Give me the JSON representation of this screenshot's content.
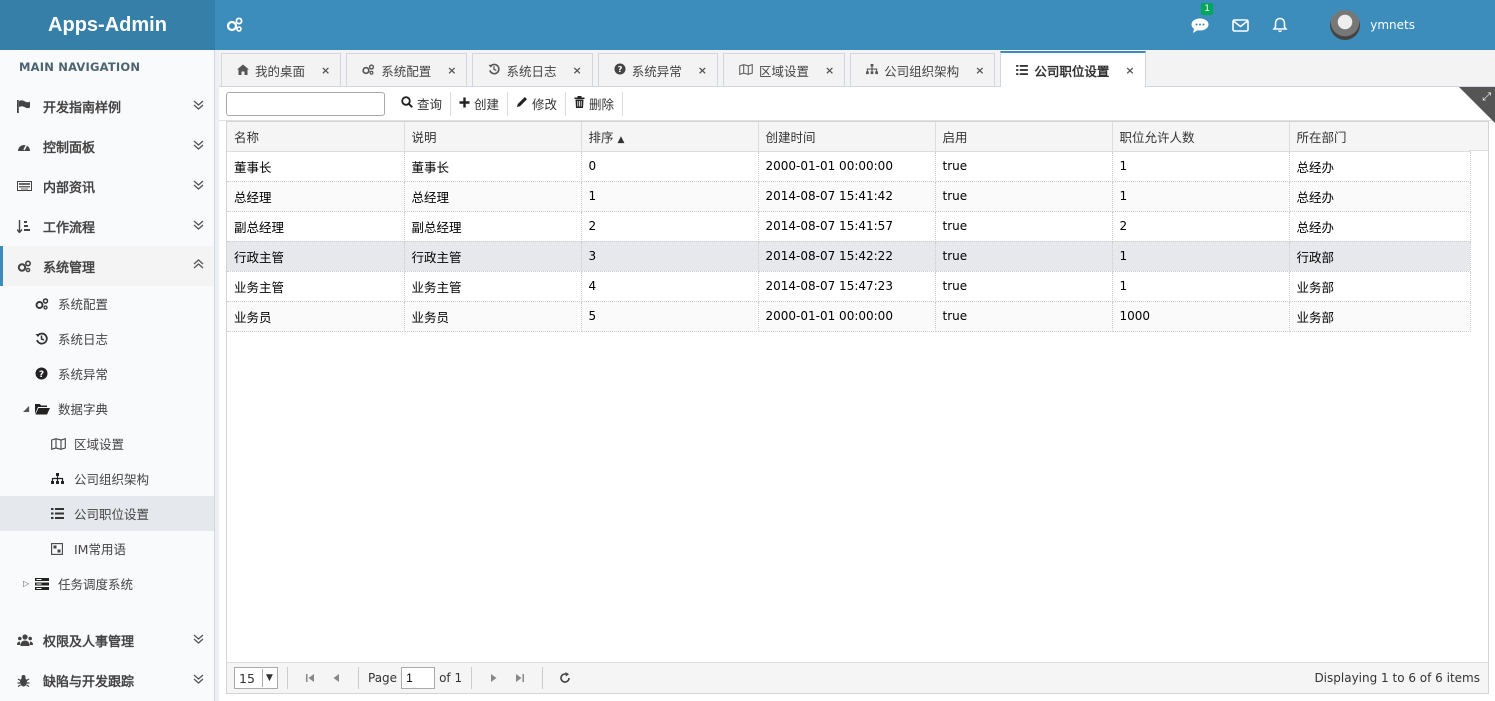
{
  "app": {
    "title": "Apps-Admin"
  },
  "header": {
    "messages_badge": "1",
    "user_name": "ymnets"
  },
  "sidebar": {
    "heading": "MAIN NAVIGATION",
    "items": [
      {
        "label": "开发指南样例",
        "icon": "flag-icon"
      },
      {
        "label": "控制面板",
        "icon": "dashboard-icon"
      },
      {
        "label": "内部资讯",
        "icon": "keyboard-icon"
      },
      {
        "label": "工作流程",
        "icon": "sort-icon"
      },
      {
        "label": "系统管理",
        "icon": "gears-icon"
      }
    ],
    "system_children": [
      {
        "label": "系统配置",
        "icon": "gears-icon"
      },
      {
        "label": "系统日志",
        "icon": "history-icon"
      },
      {
        "label": "系统异常",
        "icon": "question-circle-icon"
      }
    ],
    "dict_folder": "数据字典",
    "dict_children": [
      {
        "label": "区域设置",
        "icon": "map-icon"
      },
      {
        "label": "公司组织架构",
        "icon": "sitemap-icon"
      },
      {
        "label": "公司职位设置",
        "icon": "list-icon"
      },
      {
        "label": "IM常用语",
        "icon": "comment-icon"
      }
    ],
    "task_folder": "任务调度系统",
    "bottom_items": [
      {
        "label": "权限及人事管理",
        "icon": "users-icon"
      },
      {
        "label": "缺陷与开发跟踪",
        "icon": "bug-icon"
      }
    ]
  },
  "tabs": [
    {
      "label": "我的桌面",
      "icon": "home-icon"
    },
    {
      "label": "系统配置",
      "icon": "gears-icon"
    },
    {
      "label": "系统日志",
      "icon": "history-icon"
    },
    {
      "label": "系统异常",
      "icon": "question-circle-icon"
    },
    {
      "label": "区域设置",
      "icon": "map-icon"
    },
    {
      "label": "公司组织架构",
      "icon": "sitemap-icon"
    },
    {
      "label": "公司职位设置",
      "icon": "list-icon",
      "active": true
    }
  ],
  "toolbar": {
    "query": "查询",
    "create": "创建",
    "edit": "修改",
    "delete": "删除"
  },
  "grid": {
    "columns": [
      "名称",
      "说明",
      "排序",
      "创建时间",
      "启用",
      "职位允许人数",
      "所在部门"
    ],
    "sort_column": "排序",
    "rows": [
      [
        "董事长",
        "董事长",
        "0",
        "2000-01-01 00:00:00",
        "true",
        "1",
        "总经办"
      ],
      [
        "总经理",
        "总经理",
        "1",
        "2014-08-07 15:41:42",
        "true",
        "1",
        "总经办"
      ],
      [
        "副总经理",
        "副总经理",
        "2",
        "2014-08-07 15:41:57",
        "true",
        "2",
        "总经办"
      ],
      [
        "行政主管",
        "行政主管",
        "3",
        "2014-08-07 15:42:22",
        "true",
        "1",
        "行政部"
      ],
      [
        "业务主管",
        "业务主管",
        "4",
        "2014-08-07 15:47:23",
        "true",
        "1",
        "业务部"
      ],
      [
        "业务员",
        "业务员",
        "5",
        "2000-01-01 00:00:00",
        "true",
        "1000",
        "业务部"
      ]
    ],
    "highlighted_row": 3
  },
  "pager": {
    "page_size": "15",
    "page_label": "Page",
    "page_value": "1",
    "of_label": "of 1",
    "info": "Displaying 1 to 6 of 6 items"
  },
  "colors": {
    "brand": "#3c8dbc",
    "logo_bg": "#367fa9",
    "badge": "#00a65a"
  }
}
